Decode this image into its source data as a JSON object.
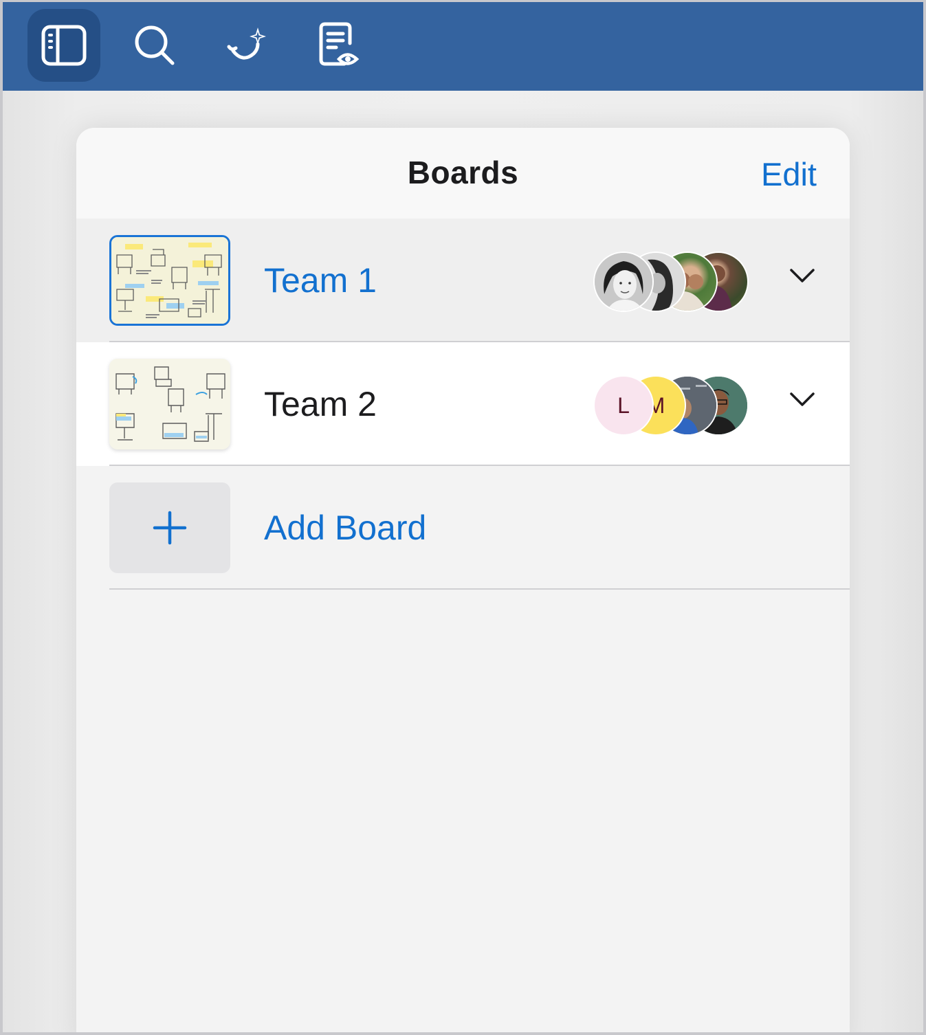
{
  "toolbar": {
    "buttons": [
      {
        "name": "sidebar-toggle",
        "icon": "sidebar-icon",
        "active": true
      },
      {
        "name": "search",
        "icon": "search-icon",
        "active": false
      },
      {
        "name": "assist",
        "icon": "sparkle-curve-icon",
        "active": false
      },
      {
        "name": "view-document",
        "icon": "document-eye-icon",
        "active": false
      }
    ],
    "colors": {
      "background": "#34639f",
      "active": "#254f86"
    }
  },
  "panel": {
    "title": "Boards",
    "edit_label": "Edit",
    "boards": [
      {
        "name": "Team 1",
        "selected": true,
        "thumbnail": "chair-sketch-annotated",
        "collaborators": [
          {
            "type": "photo",
            "icon": "person-photo-bw"
          },
          {
            "type": "photo",
            "icon": "person-photo-bw"
          },
          {
            "type": "photo",
            "icon": "person-photo-color"
          },
          {
            "type": "photo",
            "icon": "person-photo-color"
          }
        ]
      },
      {
        "name": "Team 2",
        "selected": false,
        "thumbnail": "chair-sketch",
        "collaborators": [
          {
            "type": "initial",
            "initial": "L",
            "color": "#f9e4ee"
          },
          {
            "type": "initial",
            "initial": "M",
            "color": "#fbe05a"
          },
          {
            "type": "photo",
            "icon": "person-photo-color"
          },
          {
            "type": "photo",
            "icon": "person-photo-color"
          }
        ]
      }
    ],
    "add_board_label": "Add Board"
  },
  "colors": {
    "accent": "#1270cf",
    "selection": "#1a74d6"
  }
}
